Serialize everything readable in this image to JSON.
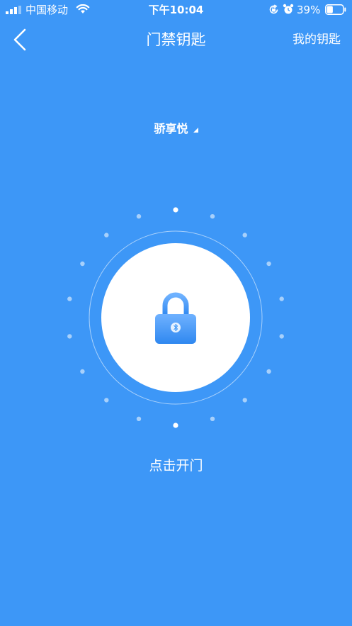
{
  "status_bar": {
    "carrier": "中国移动",
    "time": "下午10:04",
    "battery_percent": "39%",
    "battery_level": 0.39
  },
  "nav": {
    "title": "门禁钥匙",
    "my_keys_label": "我的钥匙"
  },
  "community": {
    "name": "骄享悦"
  },
  "unlock": {
    "label": "点击开门"
  },
  "colors": {
    "background": "#3d97f7",
    "lock_top": "#6fb2ff",
    "lock_bottom": "#2f88f0",
    "circle": "#ffffff"
  },
  "icons": {
    "back": "chevron-left-icon",
    "lock": "lock-icon",
    "bluetooth": "bluetooth-icon",
    "caret": "caret-down-icon",
    "signal": "signal-icon",
    "wifi": "wifi-icon",
    "rotation_lock": "rotation-lock-icon",
    "alarm": "alarm-icon",
    "battery": "battery-icon"
  }
}
